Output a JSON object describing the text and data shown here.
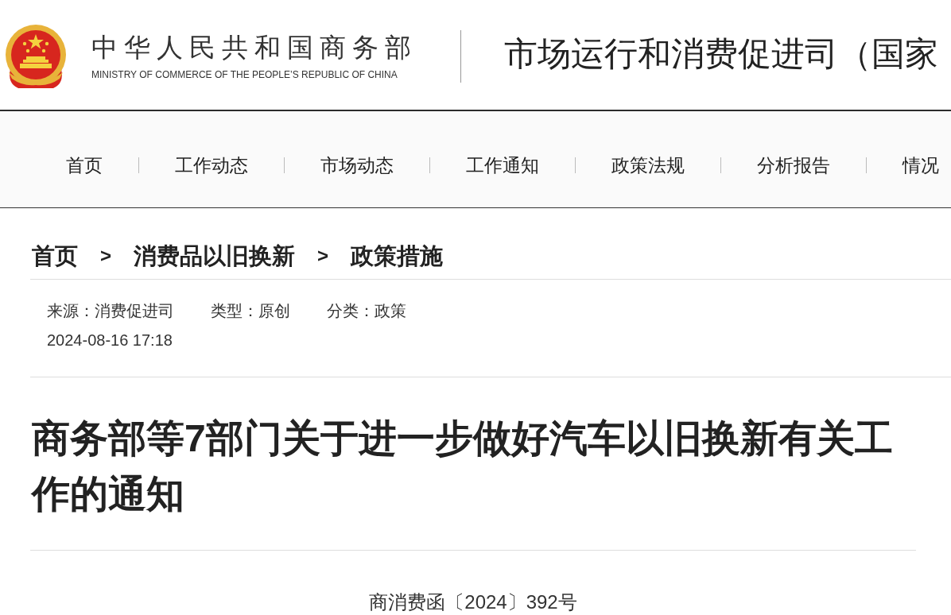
{
  "header": {
    "name_cn": "中华人民共和国商务部",
    "name_en": "MINISTRY OF COMMERCE OF THE PEOPLE’S REPUBLIC OF CHINA",
    "department": "市场运行和消费促进司（国家"
  },
  "nav": {
    "items": [
      {
        "label": "首页"
      },
      {
        "label": "工作动态"
      },
      {
        "label": "市场动态"
      },
      {
        "label": "工作通知"
      },
      {
        "label": "政策法规"
      },
      {
        "label": "分析报告"
      },
      {
        "label": "情况"
      }
    ]
  },
  "breadcrumb": {
    "items": [
      {
        "label": "首页",
        "separator": ">"
      },
      {
        "label": "消费品以旧换新",
        "separator": ">"
      },
      {
        "label": "政策措施"
      }
    ]
  },
  "article": {
    "meta": [
      "来源：消费促进司",
      "类型：原创",
      "分类：政策"
    ],
    "date": "2024-08-16 17:18",
    "title": "商务部等7部门关于进一步做好汽车以旧换新有关工作的通知",
    "document_number": "商消费函〔2024〕392号"
  }
}
